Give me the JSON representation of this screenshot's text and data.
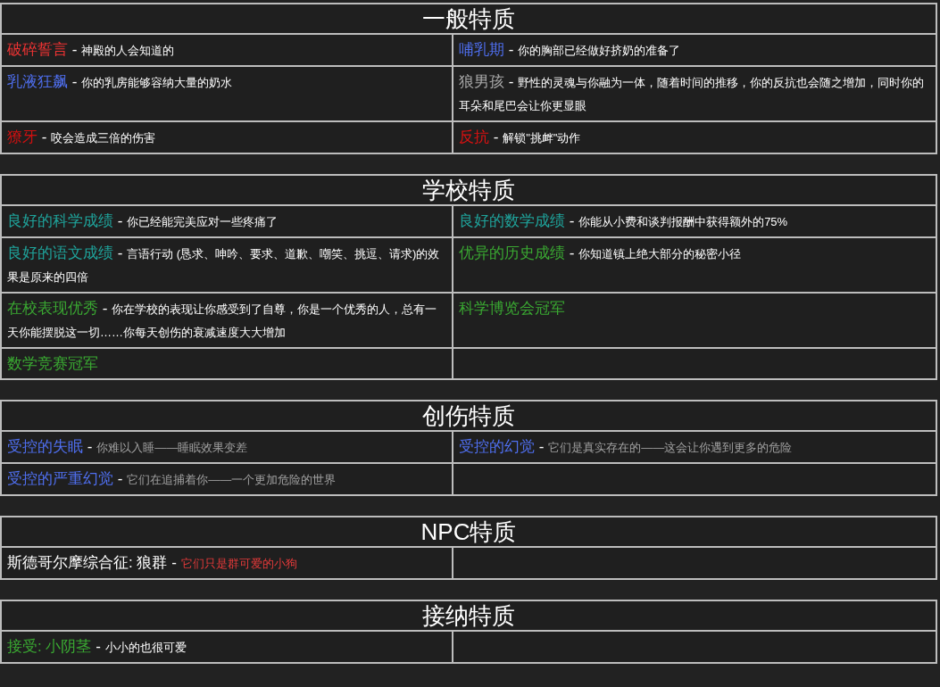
{
  "sections": [
    {
      "title": "一般特质",
      "traits": [
        {
          "name": "破碎誓言",
          "color": "#ee3333",
          "separator": "-",
          "description": {
            "text": "神殿的人会知道的",
            "color": "#ffffff"
          }
        },
        {
          "name": "哺乳期",
          "color": "#4f6ff0",
          "separator": "-",
          "description": {
            "text": "你的胸部已经做好挤奶的准备了",
            "color": "#ffffff"
          }
        },
        {
          "name": "乳液狂飙",
          "color": "#4f6ff0",
          "separator": "-",
          "description": {
            "text": "你的乳房能够容纳大量的奶水",
            "color": "#ffffff"
          }
        },
        {
          "name": "狼男孩",
          "color": "#a8a8a8",
          "separator": "-",
          "description": {
            "text": "野性的灵魂与你融为一体，随着时间的推移，你的反抗也会随之增加，同时你的耳朵和尾巴会让你更显眼",
            "color": "#ffffff"
          }
        },
        {
          "name": "獠牙",
          "color": "#d01010",
          "separator": "-",
          "description": {
            "text": "咬会造成三倍的伤害",
            "color": "#ffffff"
          }
        },
        {
          "name": "反抗",
          "color": "#dd1111",
          "separator": "-",
          "description": {
            "text": "解锁\"挑衅\"动作",
            "color": "#ffffff"
          }
        }
      ]
    },
    {
      "title": "学校特质",
      "traits": [
        {
          "name": "良好的科学成绩",
          "color": "#1fa39b",
          "separator": "-",
          "description": {
            "text": "你已经能完美应对一些疼痛了",
            "color": "#ffffff"
          }
        },
        {
          "name": "良好的数学成绩",
          "color": "#1fa39b",
          "separator": "-",
          "description": {
            "text": "你能从小费和谈判报酬中获得额外的75%",
            "color": "#ffffff"
          }
        },
        {
          "name": "良好的语文成绩",
          "color": "#1fa39b",
          "separator": "-",
          "description": {
            "text": "言语行动 (恳求、呻吟、要求、道歉、嘲笑、挑逗、请求)的效果是原来的四倍",
            "color": "#ffffff"
          }
        },
        {
          "name": "优异的历史成绩",
          "color": "#3aa832",
          "separator": "-",
          "description": {
            "text": "你知道镇上绝大部分的秘密小径",
            "color": "#ffffff"
          }
        },
        {
          "name": "在校表现优秀",
          "color": "#3aa832",
          "separator": "-",
          "description": {
            "text": "你在学校的表现让你感受到了自尊，你是一个优秀的人，总有一天你能摆脱这一切……你每天创伤的衰减速度大大增加",
            "color": "#ffffff"
          }
        },
        {
          "name": "科学博览会冠军",
          "color": "#3aa832"
        },
        {
          "name": "数学竞赛冠军",
          "color": "#3aa832"
        }
      ]
    },
    {
      "title": "创伤特质",
      "traits": [
        {
          "name": "受控的失眠",
          "color": "#4f6ff0",
          "separator": "-",
          "description": {
            "text": "你难以入睡——睡眠效果变差",
            "color": "#a0a0a0"
          }
        },
        {
          "name": "受控的幻觉",
          "color": "#4f6ff0",
          "separator": "-",
          "description": {
            "text": "它们是真实存在的——这会让你遇到更多的危险",
            "color": "#a0a0a0"
          }
        },
        {
          "name": "受控的严重幻觉",
          "color": "#4f6ff0",
          "separator": "-",
          "description": {
            "text": "它们在追捕着你——一个更加危险的世界",
            "color": "#a0a0a0"
          }
        }
      ]
    },
    {
      "title": "NPC特质",
      "traits": [
        {
          "name": "斯德哥尔摩综合征: 狼群",
          "color": "#ffffff",
          "separator": "-",
          "description": {
            "text": "它们只是群可爱的小狗",
            "color": "#e43a3a"
          }
        }
      ]
    },
    {
      "title": "接纳特质",
      "traits": [
        {
          "name": "接受: 小阴茎",
          "color": "#3aa832",
          "separator": "-",
          "description": {
            "text": "小小的也很可爱",
            "color": "#ffffff"
          }
        }
      ]
    }
  ]
}
